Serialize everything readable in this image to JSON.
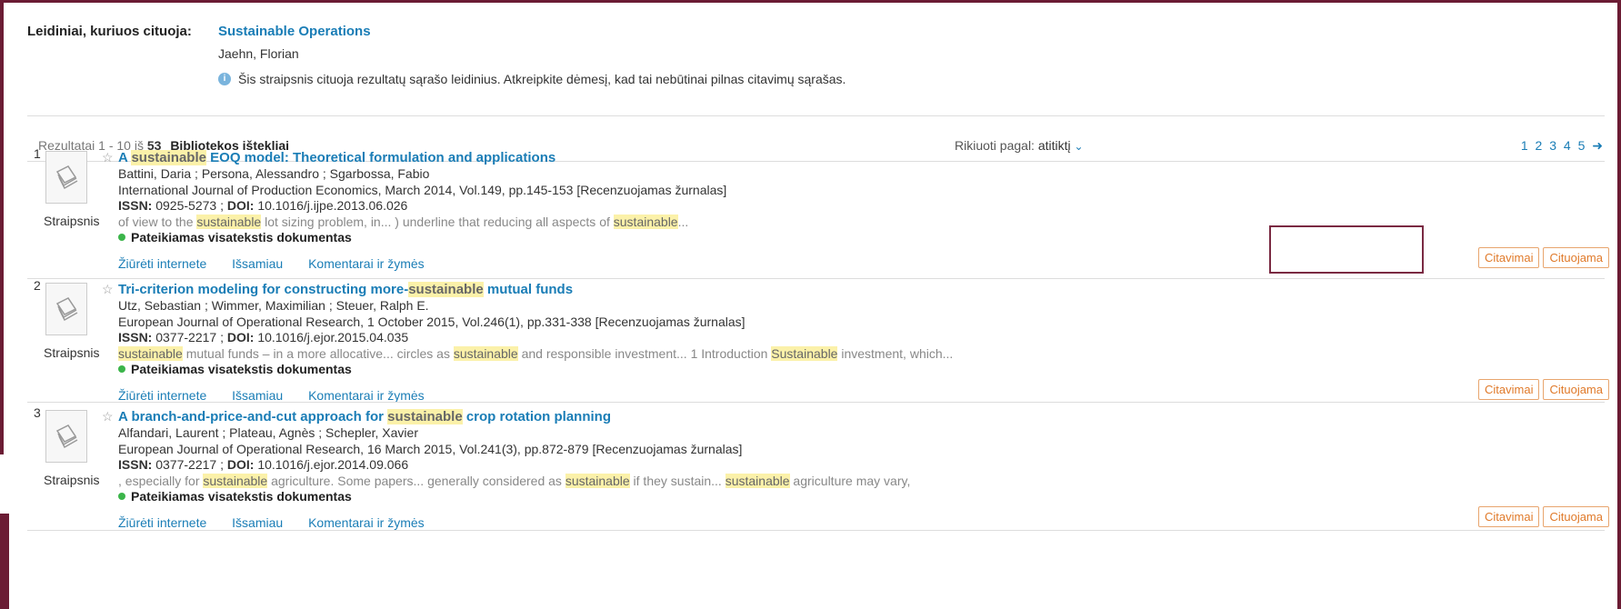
{
  "header": {
    "label": "Leidiniai, kuriuos cituoja:",
    "title": "Sustainable Operations",
    "author": "Jaehn, Florian",
    "info": "Šis straipsnis cituoja rezultatų sąrašo leidinius. Atkreipkite dėmesį, kad tai nebūtinai pilnas citavimų sąrašas."
  },
  "results_head": {
    "range": "Rezultatai 1 - 10 iš",
    "total": "53",
    "library": "Bibliotekos ištekliai",
    "sort_label": "Rikiuoti pagal:",
    "sort_value": "atitiktį",
    "pages": "1 2 3 4 5"
  },
  "results": [
    {
      "num": "1",
      "type": "Straipsnis",
      "title_pre": "A ",
      "title_hl": "sustainable",
      "title_post": " EOQ model: Theoretical formulation and applications",
      "authors": "Battini, Daria ; Persona, Alessandro ; Sgarbossa, Fabio",
      "source": "International Journal of Production Economics, March 2014, Vol.149, pp.145-153 [Recenzuojamas žurnalas]",
      "issn": "0925-5273",
      "doi": "10.1016/j.ijpe.2013.06.026",
      "snippet_1": "of view to the ",
      "snippet_hl1": "sustainable",
      "snippet_2": " lot sizing problem, in... ) underline that reducing all aspects of ",
      "snippet_hl2": "sustainable",
      "snippet_3": "...",
      "snippet_hl3": "",
      "snippet_4": "",
      "availability": "Pateikiamas visatekstis dokumentas"
    },
    {
      "num": "2",
      "type": "Straipsnis",
      "title_pre": "Tri-criterion modeling for constructing more-",
      "title_hl": "sustainable",
      "title_post": " mutual funds",
      "authors": "Utz, Sebastian ; Wimmer, Maximilian ; Steuer, Ralph E.",
      "source": "European Journal of Operational Research, 1 October 2015, Vol.246(1), pp.331-338 [Recenzuojamas žurnalas]",
      "issn": "0377-2217",
      "doi": "10.1016/j.ejor.2015.04.035",
      "snippet_1": "",
      "snippet_hl1": "sustainable",
      "snippet_2": " mutual funds – in a more allocative... circles as ",
      "snippet_hl2": "sustainable",
      "snippet_3": " and responsible investment... 1 Introduction ",
      "snippet_hl3": "Sustainable",
      "snippet_4": " investment, which...",
      "availability": "Pateikiamas visatekstis dokumentas"
    },
    {
      "num": "3",
      "type": "Straipsnis",
      "title_pre": "A branch-and-price-and-cut approach for ",
      "title_hl": "sustainable",
      "title_post": " crop rotation planning",
      "authors": "Alfandari, Laurent ; Plateau, Agnès ; Schepler, Xavier",
      "source": "European Journal of Operational Research, 16 March 2015, Vol.241(3), pp.872-879 [Recenzuojamas žurnalas]",
      "issn": "0377-2217",
      "doi": "10.1016/j.ejor.2014.09.066",
      "snippet_1": ", especially for ",
      "snippet_hl1": "sustainable",
      "snippet_2": " agriculture. Some papers... generally considered as ",
      "snippet_hl2": "sustainable",
      "snippet_3": " if they sustain... ",
      "snippet_hl3": "sustainable",
      "snippet_4": " agriculture may vary,",
      "availability": "Pateikiamas visatekstis dokumentas"
    }
  ],
  "labels": {
    "issn": "ISSN:",
    "doi": "DOI:",
    "link_online": "Žiūrėti internete",
    "link_details": "Išsamiau",
    "link_comments": "Komentarai ir žymės",
    "btn_cited": "Citavimai",
    "btn_citing": "Cituojama"
  }
}
